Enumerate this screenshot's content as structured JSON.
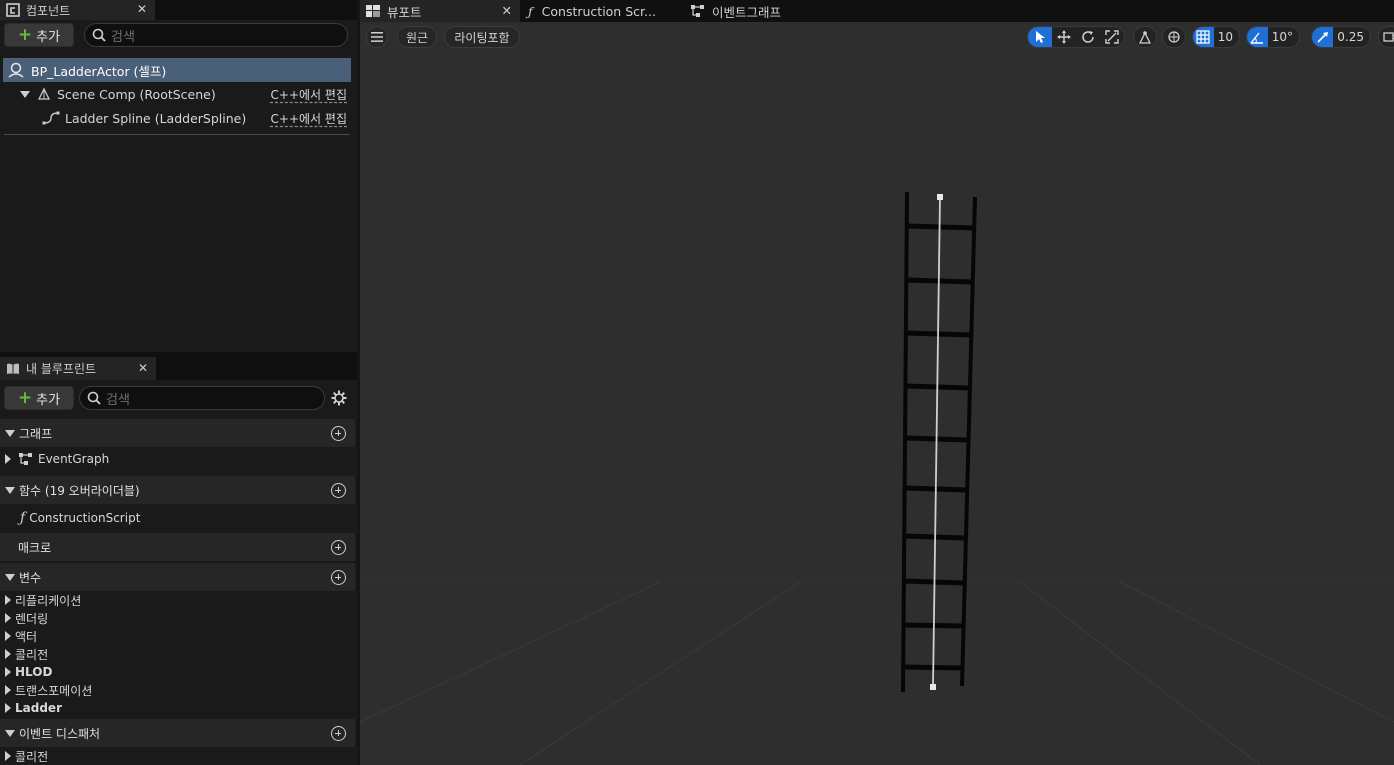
{
  "components_panel": {
    "tab_title": "컴포넌트",
    "add_label": "추가",
    "search_placeholder": "검색",
    "tree": [
      {
        "label": "BP_LadderActor (셀프)",
        "selected": true
      },
      {
        "label": "Scene Comp (RootScene)",
        "edit": "C++에서 편집"
      },
      {
        "label": "Ladder Spline (LadderSpline)",
        "edit": "C++에서 편집"
      }
    ]
  },
  "blueprint_panel": {
    "tab_title": "내 블루프린트",
    "add_label": "추가",
    "search_placeholder": "검색",
    "graphs": {
      "title": "그래프",
      "items": [
        "EventGraph"
      ]
    },
    "functions": {
      "title": "함수 (19 오버라이더블)",
      "items": [
        "ConstructionScript"
      ]
    },
    "macros": {
      "title": "매크로"
    },
    "variables": {
      "title": "변수",
      "items": [
        "리플리케이션",
        "렌더링",
        "액터",
        "콜리전",
        "HLOD",
        "트랜스포메이션",
        "Ladder"
      ]
    },
    "dispatchers": {
      "title": "이벤트 디스패처",
      "items": [
        "콜리전"
      ]
    }
  },
  "viewport": {
    "tabs": [
      "뷰포트",
      "Construction Scr...",
      "이벤트그래프"
    ],
    "perspective_label": "원근",
    "lighting_label": "라이팅포함",
    "grid_snap": "10",
    "rotation_snap": "10°",
    "scale_snap": "0.25",
    "colors": {
      "accent": "#1f6fd6",
      "background": "#2e2e2e"
    }
  }
}
